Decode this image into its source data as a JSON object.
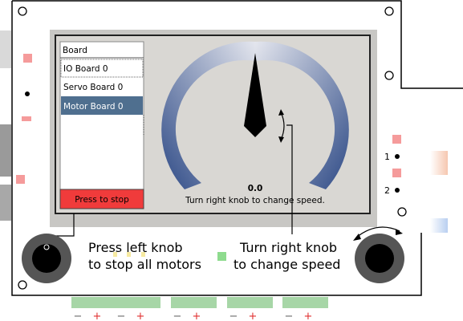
{
  "screen": {
    "list_header": "Board",
    "list_items": [
      {
        "label": "IO Board 0",
        "selected": false,
        "focused": true
      },
      {
        "label": "Servo Board 0",
        "selected": false,
        "focused": false
      },
      {
        "label": "Motor Board 0",
        "selected": true,
        "focused": false
      }
    ],
    "stop_button_label": "Press to stop",
    "speed_value": "0.0",
    "speed_hint": "Turn right knob to change speed."
  },
  "callouts": {
    "left": {
      "line1": "Press left knob",
      "line2": "to stop all motors"
    },
    "right": {
      "line1": "Turn right knob",
      "line2": "to change speed"
    }
  },
  "pins": {
    "pin1": "1",
    "pin2": "2"
  },
  "terminals": [
    {
      "minus": "−",
      "plus": "+"
    },
    {
      "minus": "−",
      "plus": "+"
    },
    {
      "minus": "−",
      "plus": "+"
    },
    {
      "minus": "−",
      "plus": "+"
    },
    {
      "minus": "−",
      "plus": "+"
    }
  ],
  "gauge": {
    "value_fraction": 0.5
  },
  "colors": {
    "gauge_dark": "#2e4a86",
    "gauge_light": "#dde0ea",
    "selected_item": "#4f6f8f",
    "stop_button": "#f03b3b",
    "screen_bg": "#d9d7d3",
    "led_red": "#f59b9b",
    "led_green": "#8edb8e",
    "terminal_green": "#a7d6a7"
  }
}
